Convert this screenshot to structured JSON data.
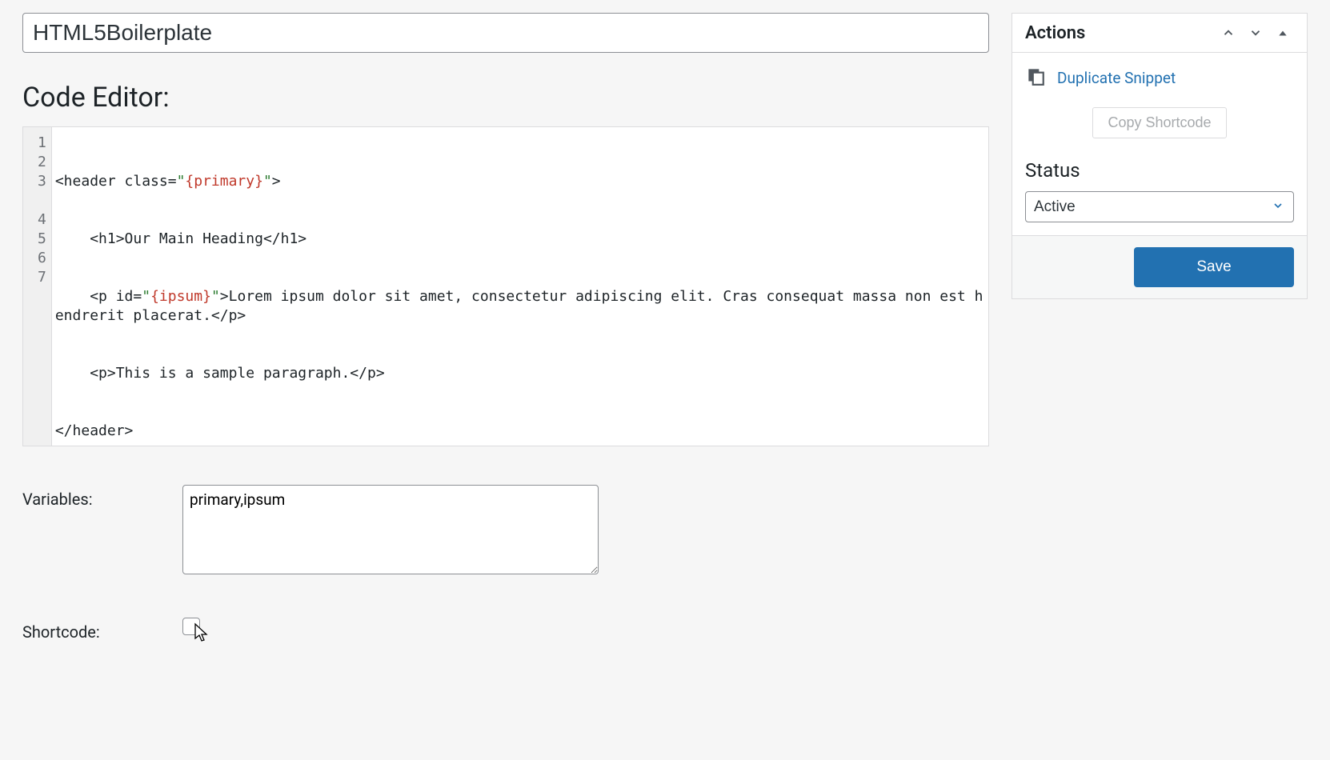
{
  "title": "HTML5Boilerplate",
  "headings": {
    "code_editor": "Code Editor:"
  },
  "code": {
    "gutter": [
      "1",
      "2",
      "3",
      "4",
      "5",
      "6",
      "7"
    ],
    "line1": {
      "a": "<header class=",
      "b": "\"",
      "c": "{primary}",
      "d": "\"",
      "e": ">"
    },
    "line2": {
      "a": "    <h1>Our Main Heading</h1>"
    },
    "line3": {
      "a": "    <p id=",
      "b": "\"",
      "c": "{ipsum}",
      "d": "\"",
      "e": ">Lorem ipsum dolor sit amet, consectetur adipiscing elit. Cras consequat massa non est hendrerit placerat.</p>"
    },
    "line4": {
      "a": "    <p>This is a sample paragraph.</p>"
    },
    "line5": {
      "a": "</header>"
    }
  },
  "fields": {
    "variables_label": "Variables:",
    "variables_value": "primary,ipsum",
    "shortcode_label": "Shortcode:"
  },
  "actions": {
    "panel_title": "Actions",
    "duplicate": "Duplicate Snippet",
    "copy_shortcode": "Copy Shortcode",
    "status_label": "Status",
    "status_value": "Active",
    "save": "Save"
  }
}
